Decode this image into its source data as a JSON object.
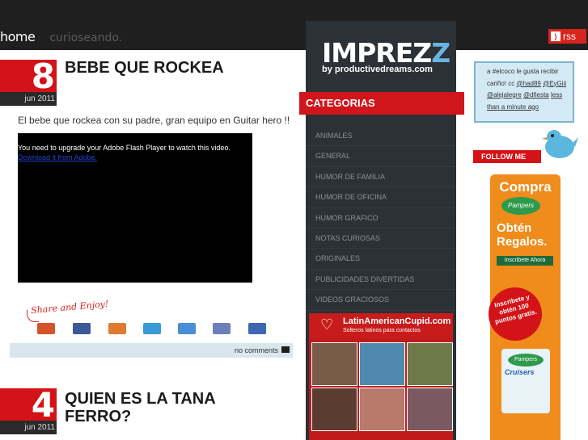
{
  "nav": {
    "home_label": "home",
    "site_label": "curioseando.",
    "rss_label": "rss"
  },
  "posts": [
    {
      "day": "8",
      "month_year": "jun 2011",
      "title": "BEBE QUE ROCKEA",
      "excerpt": "El bebe que rockea con su padre, gran equipo en Guitar hero !!",
      "video_message": "You need to upgrade your Adobe Flash Player to watch this video.",
      "video_link": "Download it from Adobe.",
      "share_label": "Share and Enjoy!",
      "comments_label": "no comments"
    },
    {
      "day": "4",
      "month_year": "jun 2011",
      "title": "QUIEN ES LA TANA FERRO?"
    }
  ],
  "sidebar": {
    "logo_main": "IMPREZ",
    "logo_accent": "Z",
    "logo_sub": "by productivedreams.com",
    "categories_heading": "CATEGORIAS",
    "categories": [
      "Animales",
      "General",
      "Humor de familia",
      "Humor de oficina",
      "Humor grafico",
      "Notas curiosas",
      "Originales",
      "Publicidades divertidas",
      "Videos graciosos"
    ],
    "ad_title": "LatinAmericanCupid.com",
    "ad_subtitle": "Solteros latinos para contactos"
  },
  "twitter": {
    "prefix": "a",
    "hashtag": "#elcoco",
    "text": "le gusta recibir cariño! cc",
    "mention1": "@had89",
    "mention2": "@EyGiii",
    "mention3": "@alejalegre",
    "mention4": "@dfiesta",
    "time": "less than a minute ago",
    "follow_label": "FOLLOW ME"
  },
  "ad_pampers": {
    "headline": "Compra",
    "brand": "Pampers",
    "offer": "Obtén Regalos.",
    "button": "Inscribete Ahora",
    "badge": "Inscríbete y obtén 100 puntos gratis.",
    "product": "Cruisers"
  },
  "colors": {
    "accent_red": "#d31317",
    "sidebar_bg": "#2b3136",
    "twitter_bg": "#d3eaf4",
    "pampers_orange": "#ef8c1b"
  }
}
